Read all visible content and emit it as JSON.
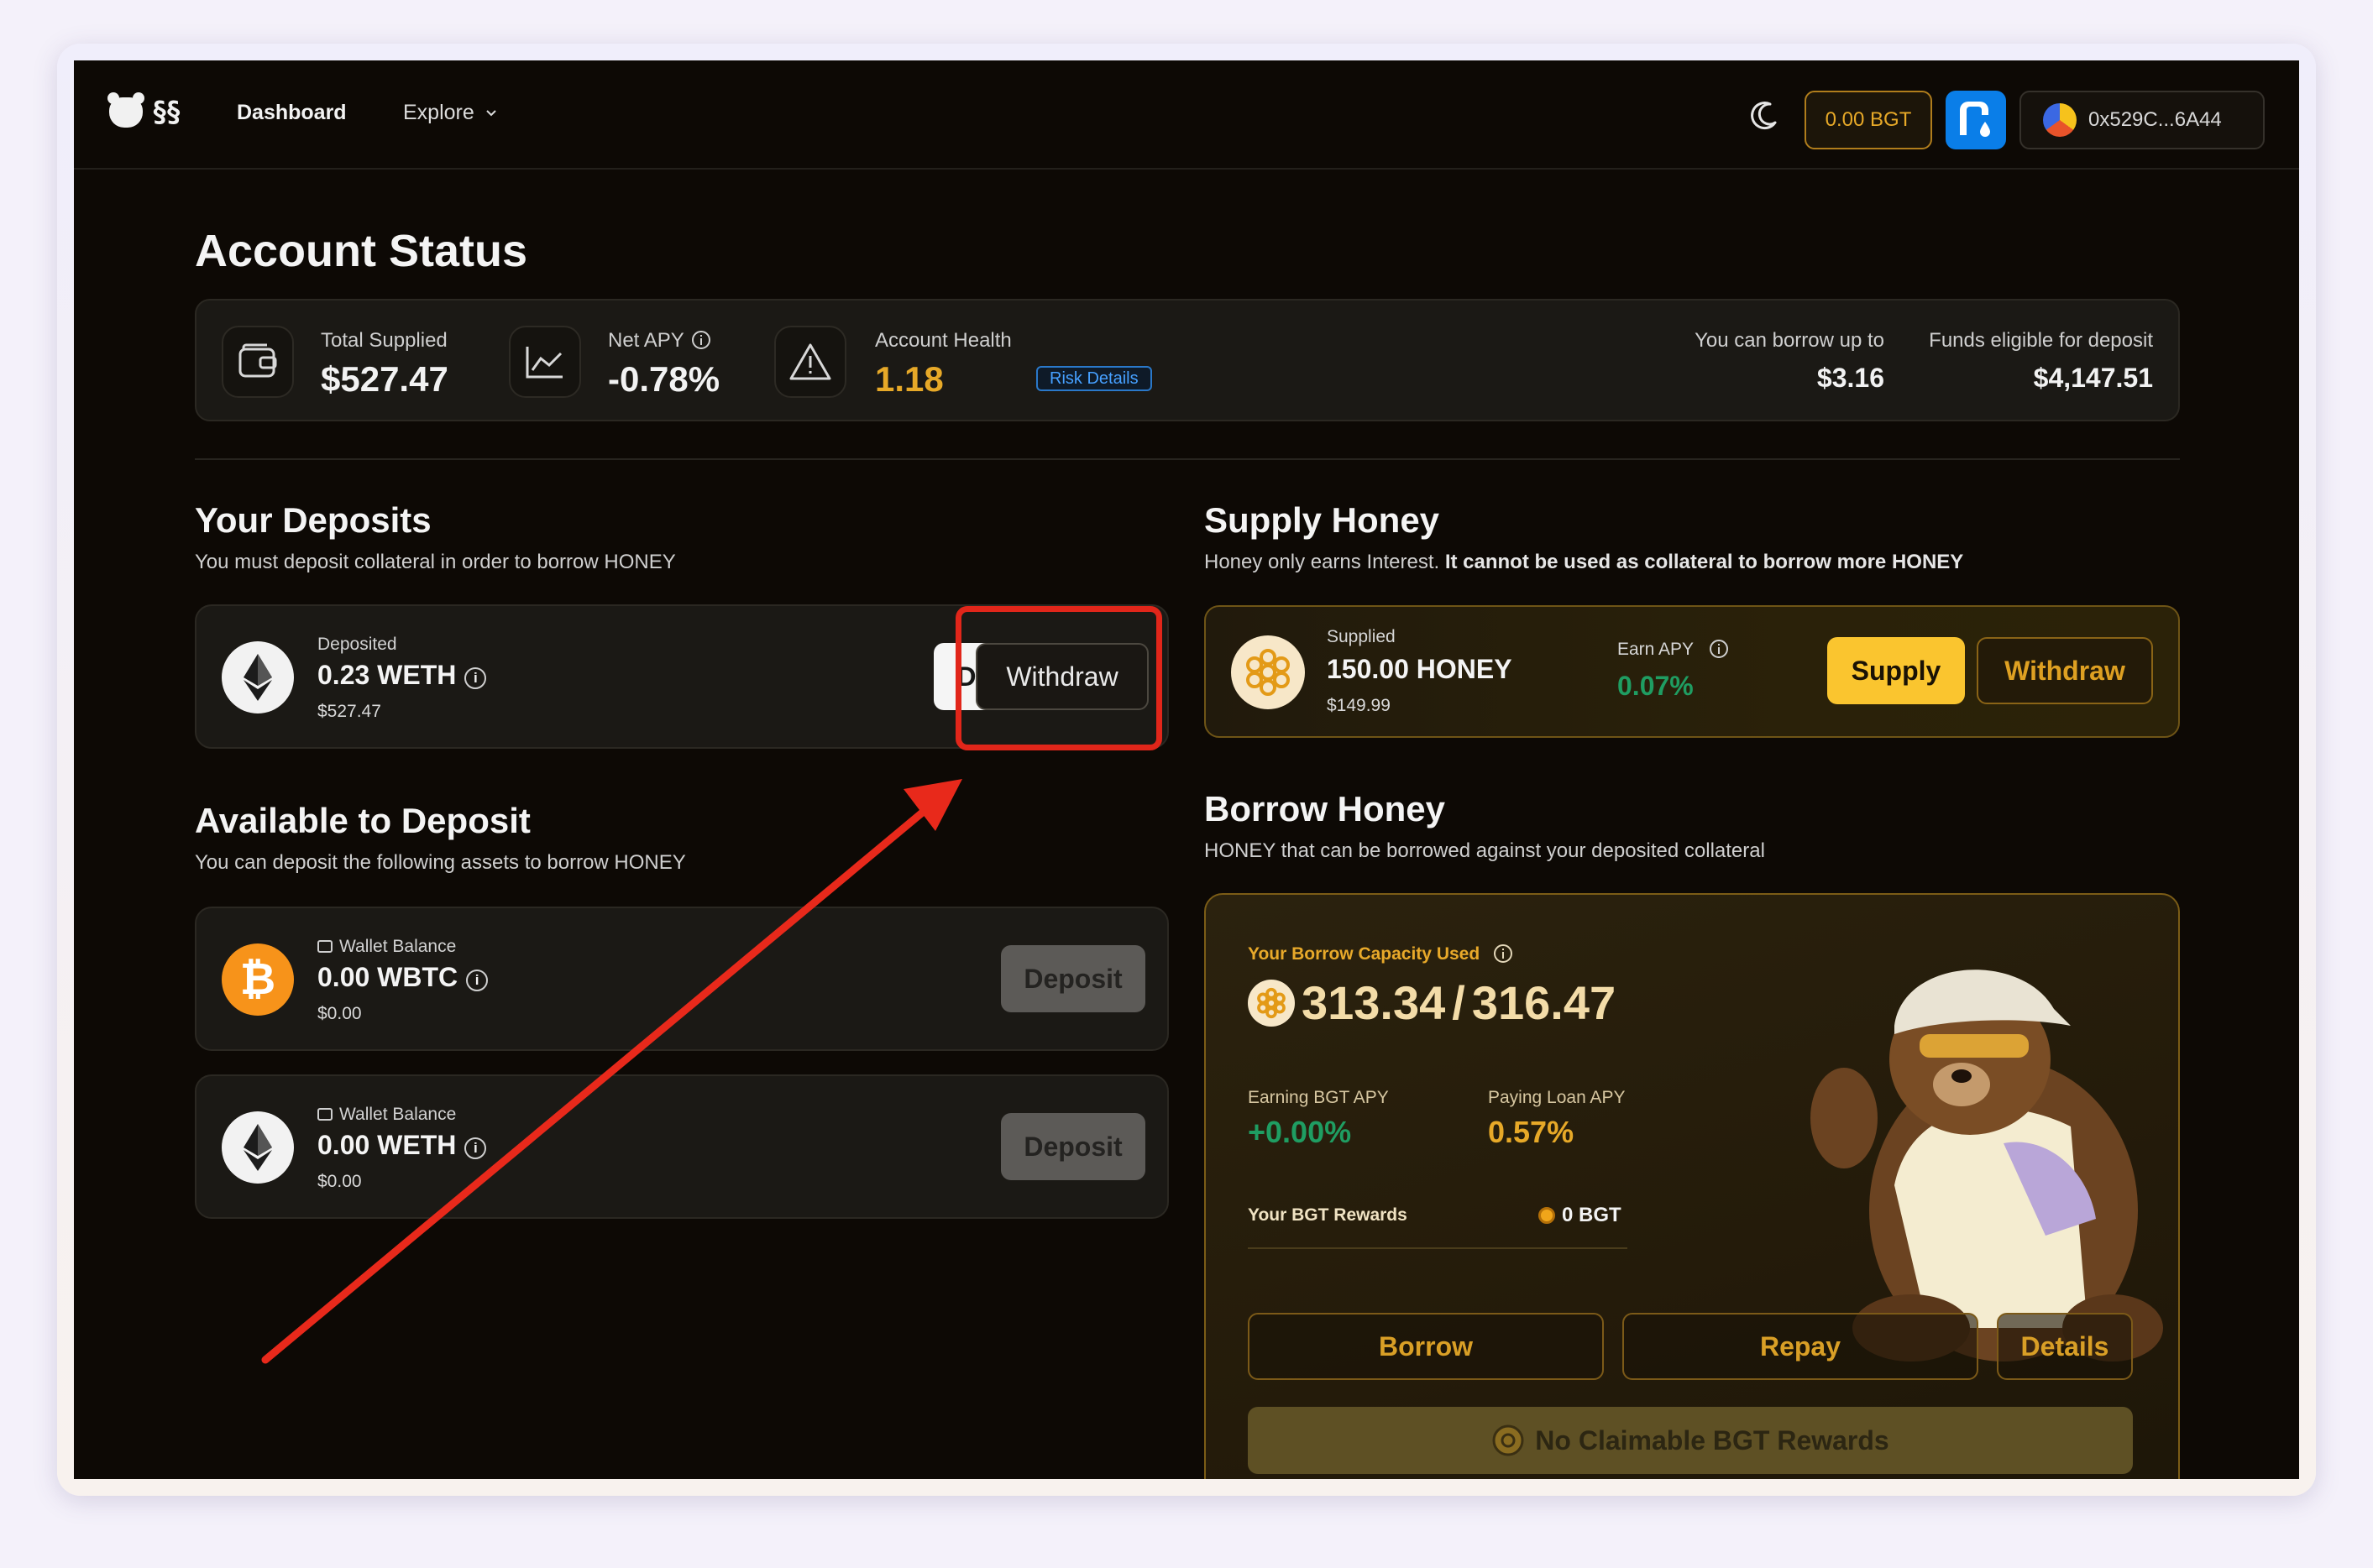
{
  "nav": {
    "dashboard": "Dashboard",
    "explore": "Explore",
    "bgt_balance": "0.00 BGT",
    "wallet_address": "0x529C...6A44"
  },
  "account": {
    "title": "Account Status",
    "total_supplied_label": "Total Supplied",
    "total_supplied_value": "$527.47",
    "net_apy_label": "Net APY",
    "net_apy_value": "-0.78%",
    "health_label": "Account Health",
    "health_value": "1.18",
    "risk_details": "Risk Details",
    "borrow_up_to_label": "You can borrow up to",
    "borrow_up_to_value": "$3.16",
    "eligible_label": "Funds eligible for deposit",
    "eligible_value": "$4,147.51"
  },
  "deposits": {
    "title": "Your Deposits",
    "subtitle": "You must deposit collateral in order to borrow HONEY",
    "item": {
      "label": "Deposited",
      "amount": "0.23 WETH",
      "usd": "$527.47",
      "deposit_btn": "Deposit",
      "withdraw_btn": "Withdraw"
    }
  },
  "available": {
    "title": "Available to Deposit",
    "subtitle": "You can deposit the following assets to borrow HONEY",
    "items": [
      {
        "label": "Wallet Balance",
        "amount": "0.00 WBTC",
        "usd": "$0.00",
        "button": "Deposit"
      },
      {
        "label": "Wallet Balance",
        "amount": "0.00 WETH",
        "usd": "$0.00",
        "button": "Deposit"
      }
    ]
  },
  "supply": {
    "title": "Supply Honey",
    "subtitle_plain": "Honey only earns Interest. ",
    "subtitle_bold": "It cannot be used as collateral to borrow more HONEY",
    "supplied_label": "Supplied",
    "supplied_amount": "150.00 HONEY",
    "supplied_usd": "$149.99",
    "earn_label": "Earn APY",
    "earn_value": "0.07%",
    "supply_btn": "Supply",
    "withdraw_btn": "Withdraw"
  },
  "borrow": {
    "title": "Borrow Honey",
    "subtitle": "HONEY that can be borrowed against your deposited collateral",
    "capacity_label": "Your Borrow Capacity Used",
    "capacity_used": "313.34",
    "capacity_sep": "/",
    "capacity_total": "316.47",
    "earning_label": "Earning BGT APY",
    "earning_value": "+0.00%",
    "paying_label": "Paying Loan APY",
    "paying_value": "0.57%",
    "rewards_label": "Your BGT Rewards",
    "rewards_value": "0 BGT",
    "borrow_btn": "Borrow",
    "repay_btn": "Repay",
    "details_btn": "Details",
    "claim_btn": "No Claimable BGT Rewards"
  },
  "colors": {
    "accent_gold": "#e7a928",
    "positive_green": "#1f9d62",
    "annotation_red": "#e1261a",
    "risk_blue": "#46a0ff"
  }
}
